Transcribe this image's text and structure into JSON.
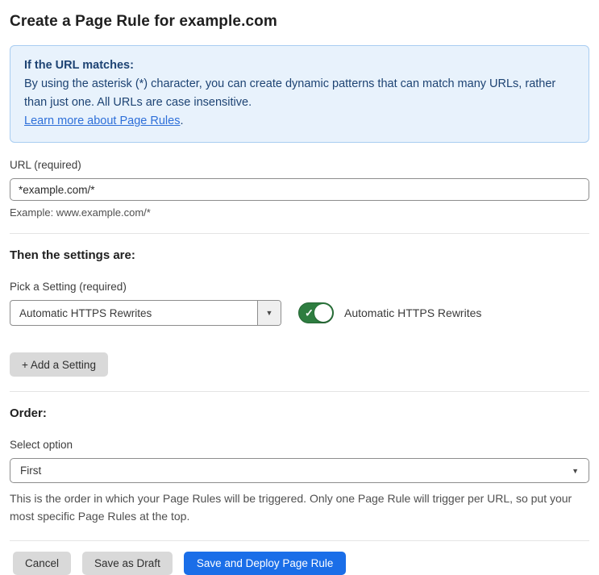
{
  "page": {
    "title": "Create a Page Rule for example.com"
  },
  "info_box": {
    "heading": "If the URL matches:",
    "body": "By using the asterisk (*) character, you can create dynamic patterns that can match many URLs, rather than just one. All URLs are case insensitive.",
    "link_text": "Learn more about Page Rules",
    "link_suffix": "."
  },
  "url_field": {
    "label": "URL (required)",
    "value": "*example.com/*",
    "helper": "Example: www.example.com/*"
  },
  "settings_section": {
    "heading": "Then the settings are:",
    "picker_label": "Pick a Setting (required)",
    "picker_value": "Automatic HTTPS Rewrites",
    "toggle_label": "Automatic HTTPS Rewrites",
    "toggle_state": "on",
    "add_setting_label": "+ Add a Setting"
  },
  "order_section": {
    "heading": "Order:",
    "select_label": "Select option",
    "select_value": "First",
    "helper": "This is the order in which your Page Rules will be triggered. Only one Page Rule will trigger per URL, so put your most specific Page Rules at the top."
  },
  "footer": {
    "cancel_label": "Cancel",
    "save_draft_label": "Save as Draft",
    "save_deploy_label": "Save and Deploy Page Rule"
  },
  "icons": {
    "caret_down": "▼",
    "check": "✓"
  },
  "colors": {
    "info_bg": "#e8f2fc",
    "info_border": "#a9cdf1",
    "info_text": "#1d4373",
    "link_blue": "#2d6fd9",
    "toggle_green": "#2e7d40",
    "primary_blue": "#1a6ee8",
    "gray_button": "#d9d9d9"
  }
}
